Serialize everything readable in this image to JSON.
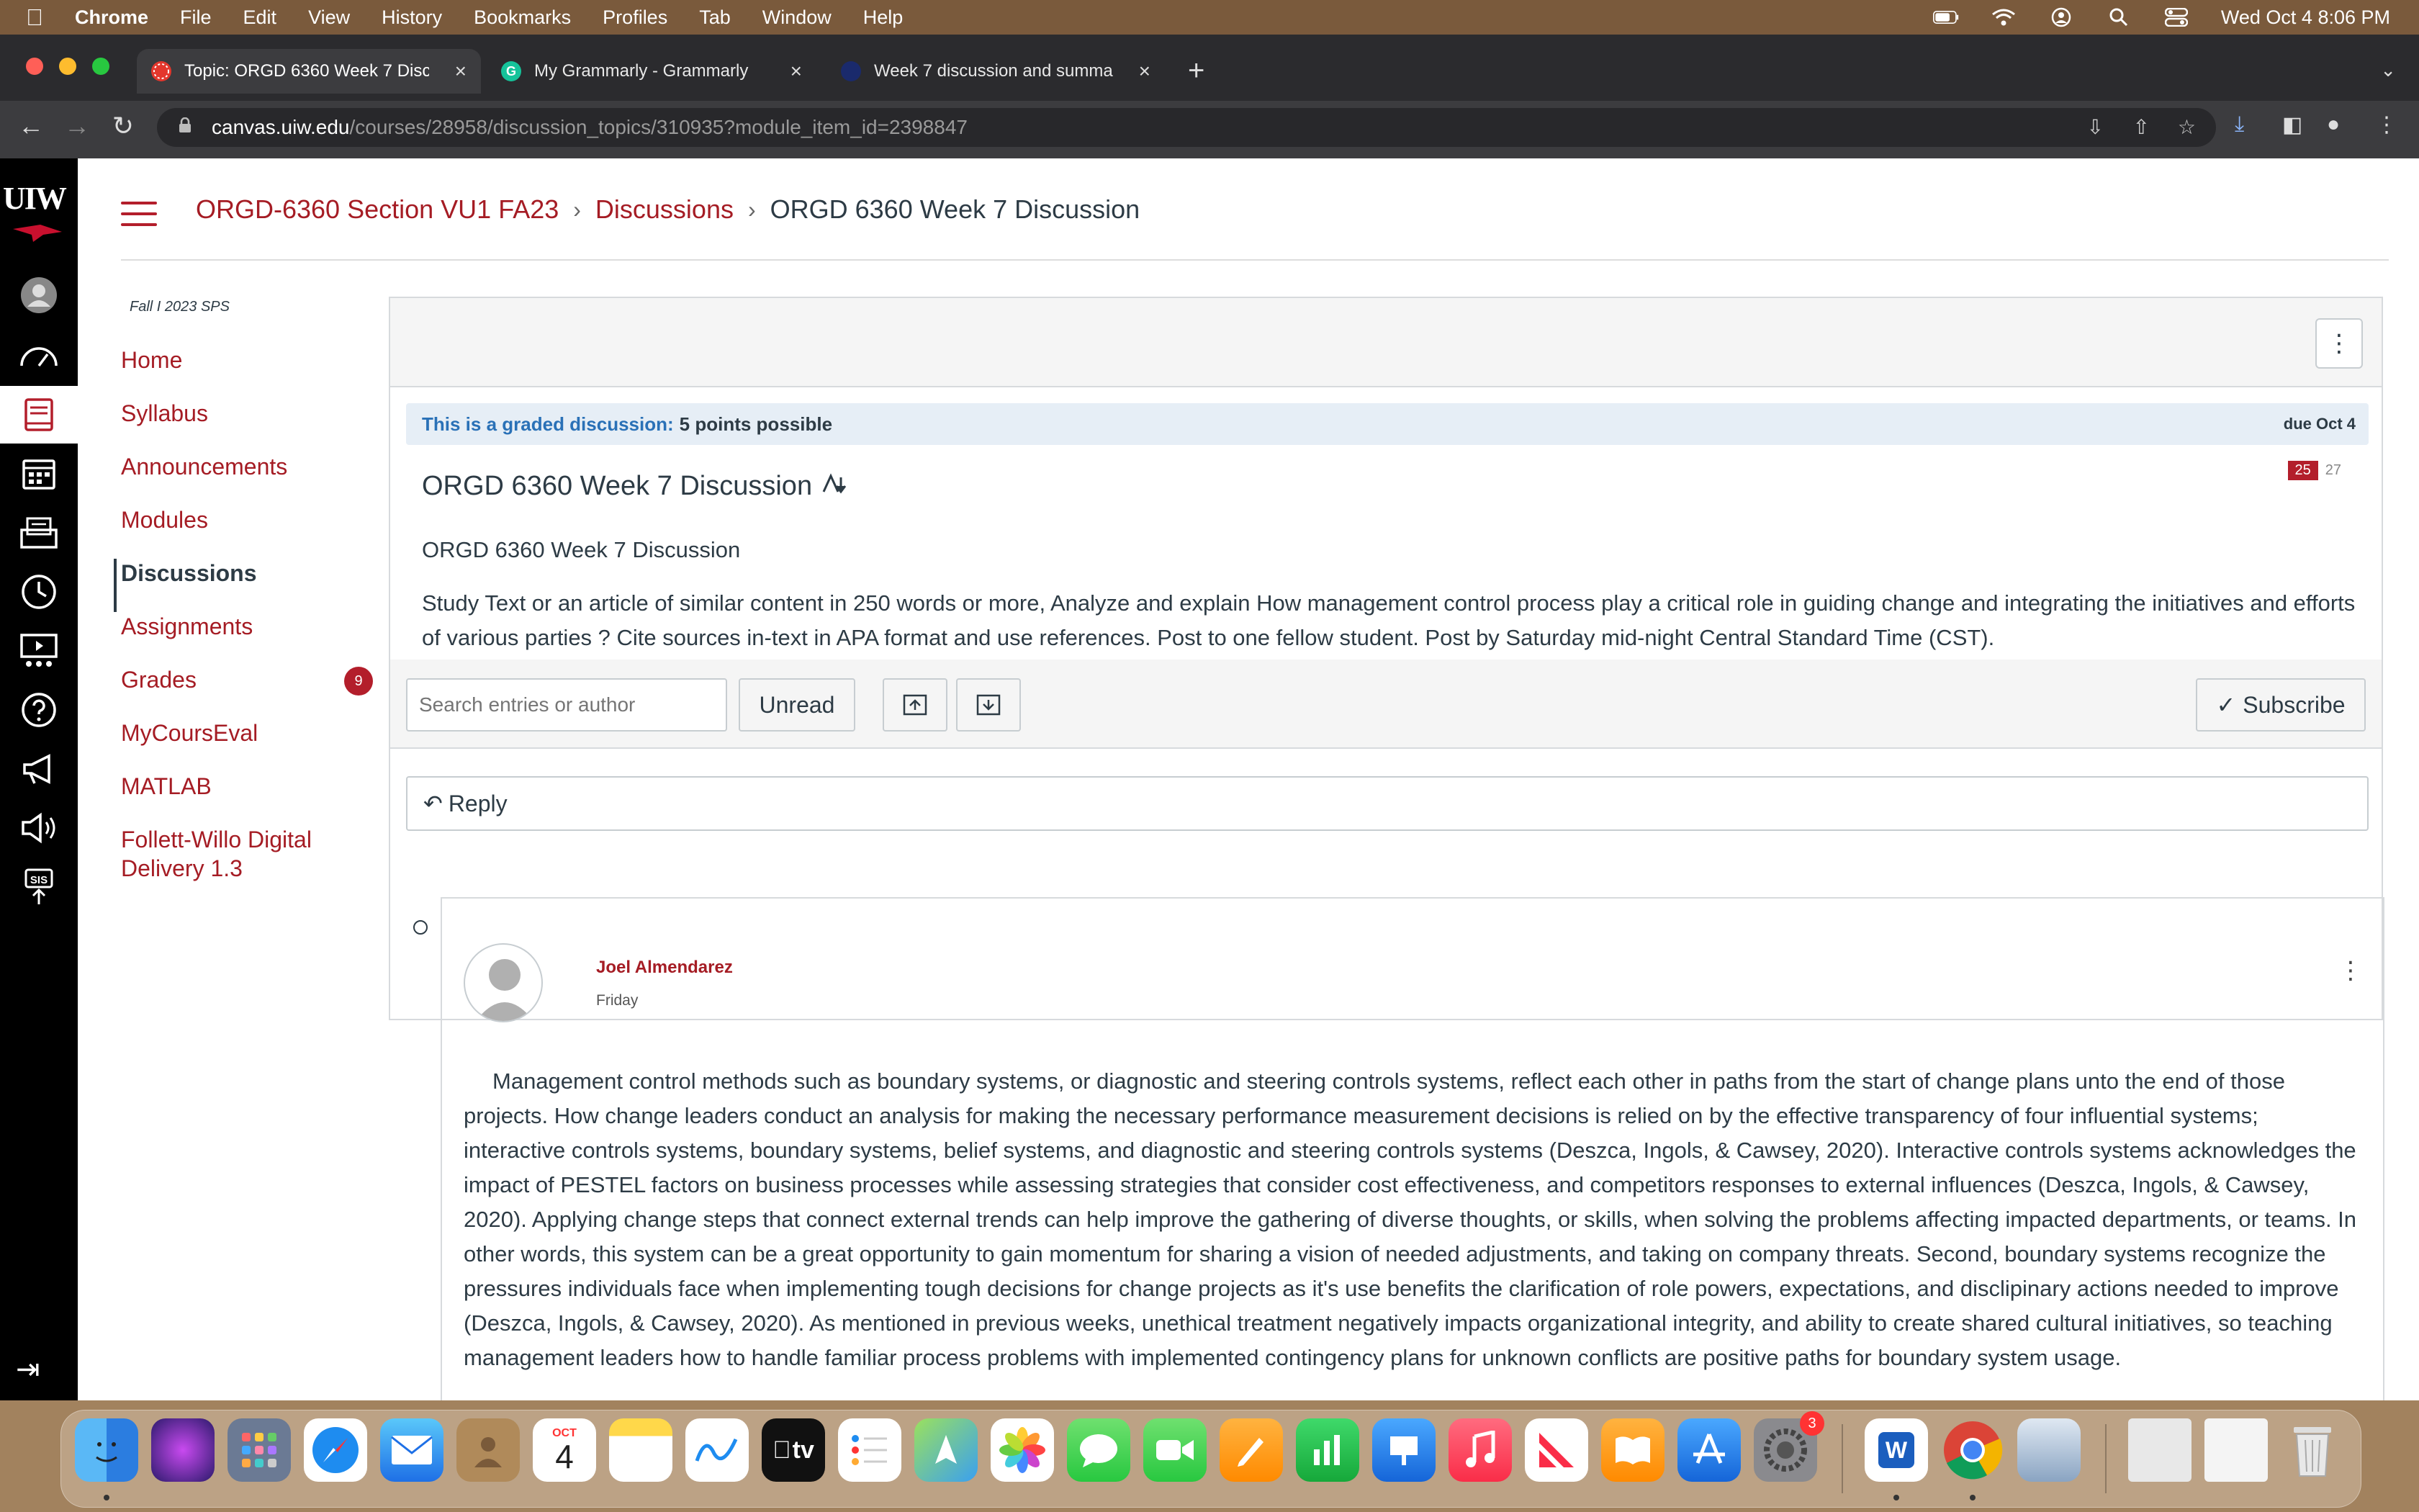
{
  "menubar": {
    "app": "Chrome",
    "items": [
      "File",
      "Edit",
      "View",
      "History",
      "Bookmarks",
      "Profiles",
      "Tab",
      "Window",
      "Help"
    ],
    "clock": "Wed Oct 4  8:06 PM"
  },
  "tabs": [
    {
      "title": "Topic: ORGD 6360 Week 7 Disc",
      "active": true
    },
    {
      "title": "My Grammarly - Grammarly",
      "active": false
    },
    {
      "title": "Week 7 discussion and summa",
      "active": false
    }
  ],
  "address": {
    "host": "canvas.uiw.edu",
    "path": "/courses/28958/discussion_topics/310935?module_item_id=2398847"
  },
  "global_nav": {
    "logo": "UIW"
  },
  "breadcrumb": {
    "course": "ORGD-6360 Section VU1 FA23",
    "section": "Discussions",
    "current": "ORGD 6360 Week 7 Discussion"
  },
  "course_nav": {
    "term": "Fall I 2023 SPS",
    "items": [
      {
        "label": "Home"
      },
      {
        "label": "Syllabus"
      },
      {
        "label": "Announcements"
      },
      {
        "label": "Modules"
      },
      {
        "label": "Discussions",
        "active": true
      },
      {
        "label": "Assignments"
      },
      {
        "label": "Grades",
        "badge": "9"
      },
      {
        "label": "MyCoursEval"
      },
      {
        "label": "MATLAB"
      },
      {
        "label": "Follett-Willo Digital Delivery 1.3"
      }
    ]
  },
  "discussion": {
    "graded_label": "This is a graded discussion:",
    "graded_value": "5 points possible",
    "due": "due Oct 4",
    "title": "ORGD 6360 Week 7 Discussion",
    "unread": "25",
    "total": "27",
    "subtitle": "ORGD 6360 Week 7 Discussion",
    "body": "Study Text  or an article of similar content in 250 words or more, Analyze and explain How management control process play a critical role in guiding change and integrating the initiatives and efforts of various parties ? Cite sources in-text in  APA format and use references. Post to one fellow student. Post by Saturday mid-night Central Standard Time (CST).",
    "search_placeholder": "Search entries or author",
    "unread_button": "Unread",
    "subscribe_button": "Subscribe",
    "reply_button": "Reply"
  },
  "entry": {
    "author": "Joel Almendarez",
    "date": "Friday",
    "body": "Management control methods such as boundary systems, or diagnostic and steering controls systems, reflect each other in paths from the start of change plans unto the end of those projects. How change leaders conduct an analysis for making the necessary performance measurement decisions is relied on by the effective transparency of four influential systems; interactive controls systems, boundary systems, belief systems, and diagnostic and steering controls systems (Deszca, Ingols, & Cawsey, 2020). Interactive controls systems acknowledges the impact of PESTEL factors on business processes while assessing strategies that consider cost effectiveness, and competitors responses to external influences (Deszca, Ingols, & Cawsey, 2020). Applying change steps that connect external trends can help improve the gathering of diverse thoughts, or skills, when solving the problems affecting impacted departments, or teams. In other words, this system can be a great opportunity to gain momentum for sharing a vision of needed adjustments, and taking on company threats. Second, boundary systems recognize the pressures individuals face when implementing tough decisions for change projects as it's use benefits the clarification of role powers, expectations, and disclipinary actions needed to improve (Deszca, Ingols, & Cawsey, 2020). As mentioned in previous weeks, unethical treatment negatively impacts organizational integrity, and ability to create shared cultural initiatives, so teaching management leaders how to handle familiar process problems with implemented contingency plans for unknown conflicts are positive paths for boundary system usage."
  },
  "dock": {
    "calendar_month": "OCT",
    "calendar_day": "4",
    "settings_badge": "3",
    "tv_label": "tv",
    "word_label": "W"
  },
  "colors": {
    "canvas_red": "#a51c24",
    "text": "#2d3b45",
    "graded_blue": "#2a71b7",
    "badge_red": "#b31e2b"
  }
}
